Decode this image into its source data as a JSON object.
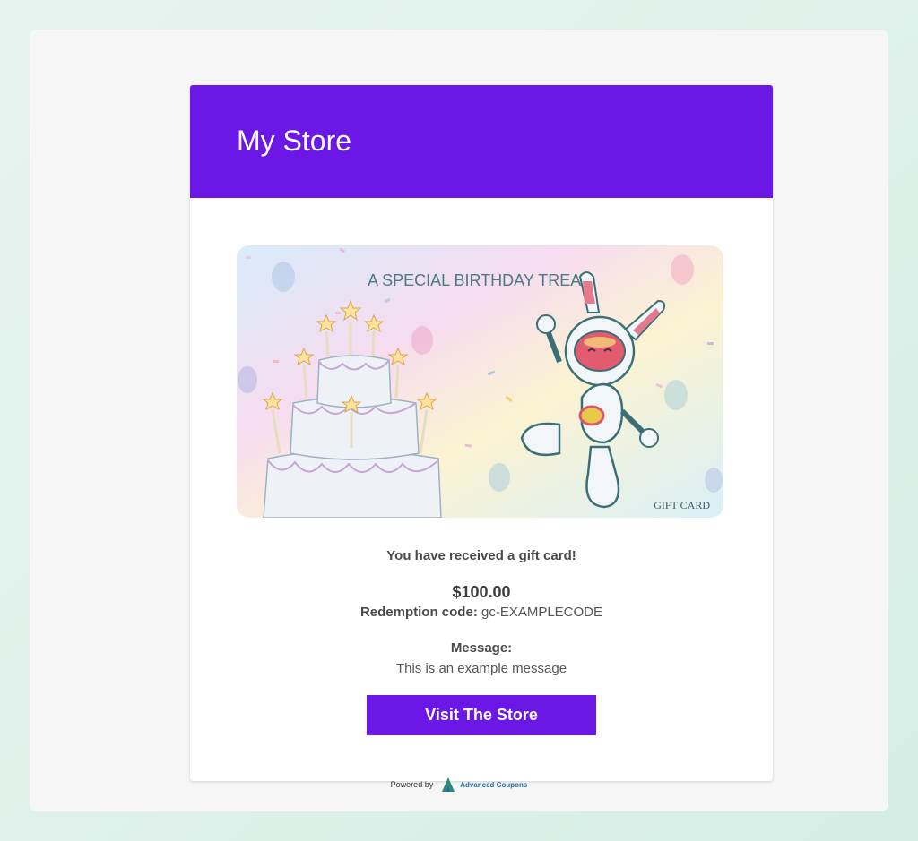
{
  "store": {
    "name": "My Store"
  },
  "gift_card": {
    "headline": "A SPECIAL BIRTHDAY TREAT",
    "corner_label": "GIFT CARD"
  },
  "content": {
    "received_text": "You have received a gift card!",
    "amount": "$100.00",
    "redemption_label": "Redemption code:",
    "redemption_code": "gc-EXAMPLECODE",
    "message_label": "Message:",
    "message_text": "This is an example message"
  },
  "cta": {
    "label": "Visit The Store"
  },
  "footer": {
    "powered_by": "Powered by",
    "brand": "Advanced Coupons"
  },
  "colors": {
    "brand": "#6b17e6",
    "background": "#f6f6f6"
  }
}
